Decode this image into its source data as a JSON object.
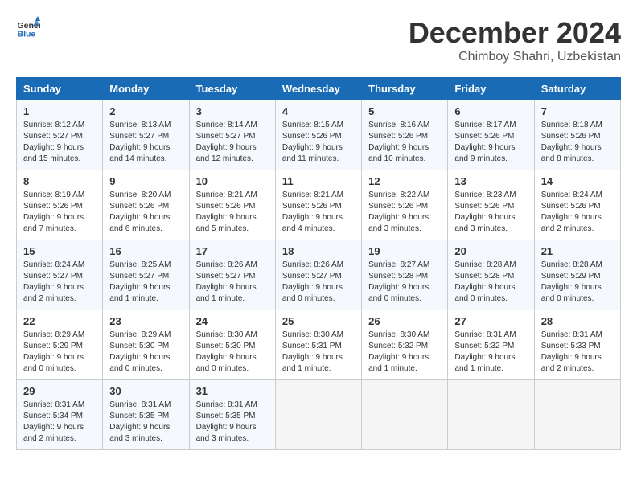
{
  "header": {
    "logo_line1": "General",
    "logo_line2": "Blue",
    "month": "December 2024",
    "location": "Chimboy Shahri, Uzbekistan"
  },
  "weekdays": [
    "Sunday",
    "Monday",
    "Tuesday",
    "Wednesday",
    "Thursday",
    "Friday",
    "Saturday"
  ],
  "weeks": [
    [
      {
        "day": "1",
        "sunrise": "8:12 AM",
        "sunset": "5:27 PM",
        "daylight": "9 hours and 15 minutes."
      },
      {
        "day": "2",
        "sunrise": "8:13 AM",
        "sunset": "5:27 PM",
        "daylight": "9 hours and 14 minutes."
      },
      {
        "day": "3",
        "sunrise": "8:14 AM",
        "sunset": "5:27 PM",
        "daylight": "9 hours and 12 minutes."
      },
      {
        "day": "4",
        "sunrise": "8:15 AM",
        "sunset": "5:26 PM",
        "daylight": "9 hours and 11 minutes."
      },
      {
        "day": "5",
        "sunrise": "8:16 AM",
        "sunset": "5:26 PM",
        "daylight": "9 hours and 10 minutes."
      },
      {
        "day": "6",
        "sunrise": "8:17 AM",
        "sunset": "5:26 PM",
        "daylight": "9 hours and 9 minutes."
      },
      {
        "day": "7",
        "sunrise": "8:18 AM",
        "sunset": "5:26 PM",
        "daylight": "9 hours and 8 minutes."
      }
    ],
    [
      {
        "day": "8",
        "sunrise": "8:19 AM",
        "sunset": "5:26 PM",
        "daylight": "9 hours and 7 minutes."
      },
      {
        "day": "9",
        "sunrise": "8:20 AM",
        "sunset": "5:26 PM",
        "daylight": "9 hours and 6 minutes."
      },
      {
        "day": "10",
        "sunrise": "8:21 AM",
        "sunset": "5:26 PM",
        "daylight": "9 hours and 5 minutes."
      },
      {
        "day": "11",
        "sunrise": "8:21 AM",
        "sunset": "5:26 PM",
        "daylight": "9 hours and 4 minutes."
      },
      {
        "day": "12",
        "sunrise": "8:22 AM",
        "sunset": "5:26 PM",
        "daylight": "9 hours and 3 minutes."
      },
      {
        "day": "13",
        "sunrise": "8:23 AM",
        "sunset": "5:26 PM",
        "daylight": "9 hours and 3 minutes."
      },
      {
        "day": "14",
        "sunrise": "8:24 AM",
        "sunset": "5:26 PM",
        "daylight": "9 hours and 2 minutes."
      }
    ],
    [
      {
        "day": "15",
        "sunrise": "8:24 AM",
        "sunset": "5:27 PM",
        "daylight": "9 hours and 2 minutes."
      },
      {
        "day": "16",
        "sunrise": "8:25 AM",
        "sunset": "5:27 PM",
        "daylight": "9 hours and 1 minute."
      },
      {
        "day": "17",
        "sunrise": "8:26 AM",
        "sunset": "5:27 PM",
        "daylight": "9 hours and 1 minute."
      },
      {
        "day": "18",
        "sunrise": "8:26 AM",
        "sunset": "5:27 PM",
        "daylight": "9 hours and 0 minutes."
      },
      {
        "day": "19",
        "sunrise": "8:27 AM",
        "sunset": "5:28 PM",
        "daylight": "9 hours and 0 minutes."
      },
      {
        "day": "20",
        "sunrise": "8:28 AM",
        "sunset": "5:28 PM",
        "daylight": "9 hours and 0 minutes."
      },
      {
        "day": "21",
        "sunrise": "8:28 AM",
        "sunset": "5:29 PM",
        "daylight": "9 hours and 0 minutes."
      }
    ],
    [
      {
        "day": "22",
        "sunrise": "8:29 AM",
        "sunset": "5:29 PM",
        "daylight": "9 hours and 0 minutes."
      },
      {
        "day": "23",
        "sunrise": "8:29 AM",
        "sunset": "5:30 PM",
        "daylight": "9 hours and 0 minutes."
      },
      {
        "day": "24",
        "sunrise": "8:30 AM",
        "sunset": "5:30 PM",
        "daylight": "9 hours and 0 minutes."
      },
      {
        "day": "25",
        "sunrise": "8:30 AM",
        "sunset": "5:31 PM",
        "daylight": "9 hours and 1 minute."
      },
      {
        "day": "26",
        "sunrise": "8:30 AM",
        "sunset": "5:32 PM",
        "daylight": "9 hours and 1 minute."
      },
      {
        "day": "27",
        "sunrise": "8:31 AM",
        "sunset": "5:32 PM",
        "daylight": "9 hours and 1 minute."
      },
      {
        "day": "28",
        "sunrise": "8:31 AM",
        "sunset": "5:33 PM",
        "daylight": "9 hours and 2 minutes."
      }
    ],
    [
      {
        "day": "29",
        "sunrise": "8:31 AM",
        "sunset": "5:34 PM",
        "daylight": "9 hours and 2 minutes."
      },
      {
        "day": "30",
        "sunrise": "8:31 AM",
        "sunset": "5:35 PM",
        "daylight": "9 hours and 3 minutes."
      },
      {
        "day": "31",
        "sunrise": "8:31 AM",
        "sunset": "5:35 PM",
        "daylight": "9 hours and 3 minutes."
      },
      null,
      null,
      null,
      null
    ]
  ]
}
